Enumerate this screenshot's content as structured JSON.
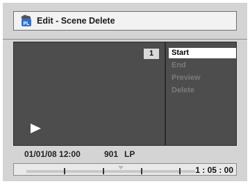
{
  "header": {
    "icon_label": "PL",
    "title": "Edit - Scene Delete"
  },
  "preview": {
    "scene_number": "1",
    "play_symbol": "play-icon"
  },
  "menu": {
    "items": [
      {
        "label": "Start",
        "selected": true
      },
      {
        "label": "End",
        "selected": false
      },
      {
        "label": "Preview",
        "selected": false
      },
      {
        "label": "Delete",
        "selected": false
      }
    ]
  },
  "info": {
    "datetime": "01/01/08 12:00",
    "channel": "901",
    "mode": "LP"
  },
  "timeline": {
    "elapsed": "1 : 05 : 00"
  }
}
